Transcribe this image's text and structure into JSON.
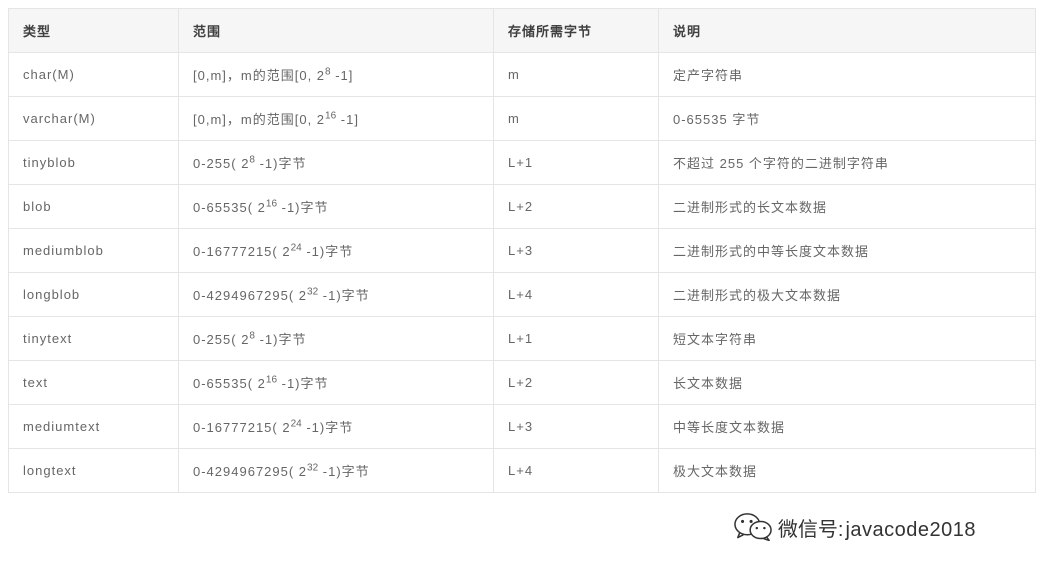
{
  "table": {
    "headers": {
      "type": "类型",
      "range": "范围",
      "storage": "存储所需字节",
      "desc": "说明"
    },
    "rows": [
      {
        "type": "char(M)",
        "range_pre": "[0,m]，m的范围[0, 2",
        "range_exp": "8",
        "range_post": " -1]",
        "storage": "m",
        "desc": "定产字符串"
      },
      {
        "type": "varchar(M)",
        "range_pre": "[0,m]，m的范围[0, 2",
        "range_exp": "16",
        "range_post": " -1]",
        "storage": "m",
        "desc": "0-65535 字节"
      },
      {
        "type": "tinyblob",
        "range_pre": "0-255( 2",
        "range_exp": "8",
        "range_post": " -1)字节",
        "storage": "L+1",
        "desc": "不超过 255 个字符的二进制字符串"
      },
      {
        "type": "blob",
        "range_pre": "0-65535( 2",
        "range_exp": "16",
        "range_post": " -1)字节",
        "storage": "L+2",
        "desc": "二进制形式的长文本数据"
      },
      {
        "type": "mediumblob",
        "range_pre": "0-16777215( 2",
        "range_exp": "24",
        "range_post": " -1)字节",
        "storage": "L+3",
        "desc": "二进制形式的中等长度文本数据"
      },
      {
        "type": "longblob",
        "range_pre": "0-4294967295( 2",
        "range_exp": "32",
        "range_post": " -1)字节",
        "storage": "L+4",
        "desc": "二进制形式的极大文本数据"
      },
      {
        "type": "tinytext",
        "range_pre": "0-255( 2",
        "range_exp": "8",
        "range_post": " -1)字节",
        "storage": "L+1",
        "desc": "短文本字符串"
      },
      {
        "type": "text",
        "range_pre": "0-65535( 2",
        "range_exp": "16",
        "range_post": " -1)字节",
        "storage": "L+2",
        "desc": "长文本数据"
      },
      {
        "type": "mediumtext",
        "range_pre": "0-16777215( 2",
        "range_exp": "24",
        "range_post": " -1)字节",
        "storage": "L+3",
        "desc": "中等长度文本数据"
      },
      {
        "type": "longtext",
        "range_pre": "0-4294967295( 2",
        "range_exp": "32",
        "range_post": " -1)字节",
        "storage": "L+4",
        "desc": "极大文本数据"
      }
    ]
  },
  "footer": {
    "label": "微信号: ",
    "value": "javacode2018"
  }
}
